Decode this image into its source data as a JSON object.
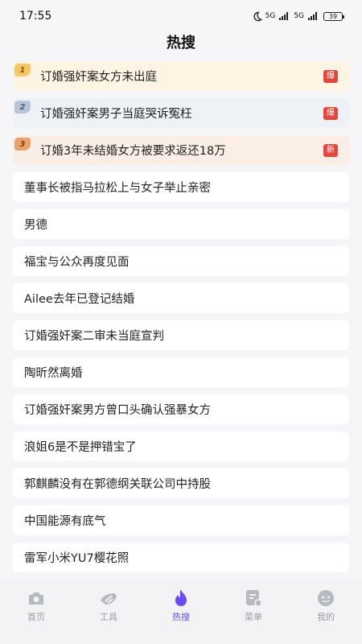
{
  "status": {
    "time": "17:55",
    "network1": "5G",
    "network2": "5G",
    "battery": "39"
  },
  "page": {
    "title": "热搜"
  },
  "hot_list": [
    {
      "rank": "1",
      "text": "订婚强奸案女方未出庭",
      "tag": "爆"
    },
    {
      "rank": "2",
      "text": "订婚强奸案男子当庭哭诉冤枉",
      "tag": "爆"
    },
    {
      "rank": "3",
      "text": "订婚3年未结婚女方被要求返还18万",
      "tag": "新"
    },
    {
      "text": "董事长被指马拉松上与女子举止亲密"
    },
    {
      "text": "男德"
    },
    {
      "text": "福宝与公众再度见面"
    },
    {
      "text": "Ailee去年已登记结婚"
    },
    {
      "text": "订婚强奸案二审未当庭宣判"
    },
    {
      "text": "陶昕然离婚"
    },
    {
      "text": "订婚强奸案男方曾口头确认强暴女方"
    },
    {
      "text": "浪姐6是不是押错宝了"
    },
    {
      "text": "郭麒麟没有在郭德纲关联公司中持股"
    },
    {
      "text": "中国能源有底气"
    },
    {
      "text": "雷军小米YU7樱花照"
    }
  ],
  "tabs": [
    {
      "label": "首页",
      "icon": "camera-home-icon"
    },
    {
      "label": "工具",
      "icon": "tools-icon"
    },
    {
      "label": "热搜",
      "icon": "flame-icon"
    },
    {
      "label": "菜单",
      "icon": "menu-list-icon"
    },
    {
      "label": "我的",
      "icon": "profile-face-icon"
    }
  ],
  "colors": {
    "accent": "#6a4df0",
    "hot_tag": "#e2483d",
    "rank1_bg": "#fdf4e4",
    "rank2_bg": "#eef1f6",
    "rank3_bg": "#fbeee6"
  }
}
